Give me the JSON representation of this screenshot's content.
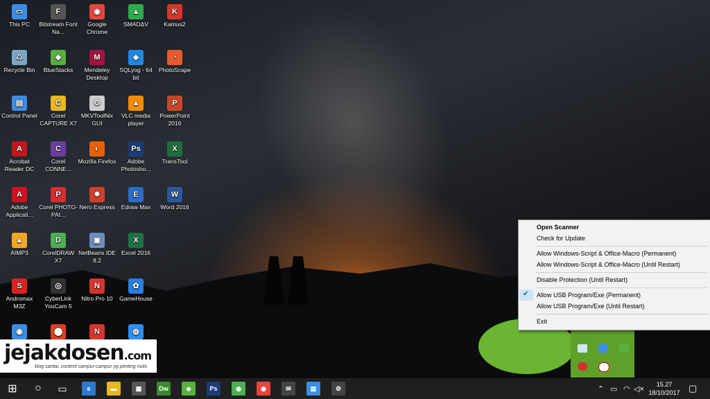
{
  "desktop": {
    "icons": [
      {
        "label": "This PC",
        "glyph": "▭",
        "color": "#3a8ee6"
      },
      {
        "label": "Recycle Bin",
        "glyph": "♺",
        "color": "#7aa7c7"
      },
      {
        "label": "Control Panel",
        "glyph": "▤",
        "color": "#3a8ee6"
      },
      {
        "label": "Acrobat Reader DC",
        "glyph": "A",
        "color": "#c4161c"
      },
      {
        "label": "Adobe Applicati...",
        "glyph": "A",
        "color": "#d4101c"
      },
      {
        "label": "AIMP3",
        "glyph": "▲",
        "color": "#f5a623"
      },
      {
        "label": "Andromax M3Z",
        "glyph": "S",
        "color": "#e02020"
      },
      {
        "label": "",
        "glyph": "◉",
        "color": "#3a8ee6"
      },
      {
        "label": "Bitstream Font Na...",
        "glyph": "F",
        "color": "#555555"
      },
      {
        "label": "BlueStacks",
        "glyph": "◆",
        "color": "#57b13a"
      },
      {
        "label": "Corel CAPTURE X7",
        "glyph": "C",
        "color": "#e8b820"
      },
      {
        "label": "Corel CONNE...",
        "glyph": "C",
        "color": "#6a3ea1"
      },
      {
        "label": "Corel PHOTO-PAI...",
        "glyph": "P",
        "color": "#d22f2f"
      },
      {
        "label": "CorelDRAW X7",
        "glyph": "D",
        "color": "#4caf50"
      },
      {
        "label": "CyberLink YouCam 5",
        "glyph": "◎",
        "color": "#333333"
      },
      {
        "label": "",
        "glyph": "⬤",
        "color": "#e04020"
      },
      {
        "label": "Google Chrome",
        "glyph": "◉",
        "color": "#e8453c"
      },
      {
        "label": "Mendeley Desktop",
        "glyph": "M",
        "color": "#a8123e"
      },
      {
        "label": "MKVToolNix GUI",
        "glyph": "⚙",
        "color": "#cccccc"
      },
      {
        "label": "Mozilla Firefox",
        "glyph": "◐",
        "color": "#e66000"
      },
      {
        "label": "Nero Express",
        "glyph": "✸",
        "color": "#d0402a"
      },
      {
        "label": "NetBeans IDE 8.2",
        "glyph": "▣",
        "color": "#6b8fc4"
      },
      {
        "label": "Nitro Pro 10",
        "glyph": "N",
        "color": "#d9342b"
      },
      {
        "label": "",
        "glyph": "N",
        "color": "#d9342b"
      },
      {
        "label": "SMADΔV",
        "glyph": "▲",
        "color": "#2eab4f"
      },
      {
        "label": "SQLyog - 64 bit",
        "glyph": "◈",
        "color": "#1e88e5"
      },
      {
        "label": "VLC media player",
        "glyph": "▲",
        "color": "#f28c00"
      },
      {
        "label": "Adobe Photosho...",
        "glyph": "Ps",
        "color": "#1d3b77"
      },
      {
        "label": "Edraw Max",
        "glyph": "E",
        "color": "#2c6cc7"
      },
      {
        "label": "Excel 2016",
        "glyph": "X",
        "color": "#1e7145"
      },
      {
        "label": "GameHouse",
        "glyph": "✿",
        "color": "#2a7de1"
      },
      {
        "label": "",
        "glyph": "◍",
        "color": "#2d8ef5"
      },
      {
        "label": "Kamus2",
        "glyph": "K",
        "color": "#d9342b"
      },
      {
        "label": "PhotoScape",
        "glyph": "◔",
        "color": "#e55b2d"
      },
      {
        "label": "PowerPoint 2016",
        "glyph": "P",
        "color": "#c8472a"
      },
      {
        "label": "TransTool",
        "glyph": "X",
        "color": "#1f6e3a"
      },
      {
        "label": "Word 2016",
        "glyph": "W",
        "color": "#2b579a"
      }
    ]
  },
  "watermark": {
    "main": "jejakdosen",
    "domain": ".com",
    "tagline": "blog santai, content campur-campur yg penting nulis"
  },
  "context_menu": {
    "open_scanner": "Open Scanner",
    "check_update": "Check for Update",
    "allow_script_perm": "Allow Windows-Script & Office-Macro (Permanent)",
    "allow_script_restart": "Allow Windows-Script & Office-Macro (Until Restart)",
    "disable_protection": "Disable Protection (Until Restart)",
    "allow_usb_perm": "Allow USB Program/Exe (Permanent)",
    "allow_usb_restart": "Allow USB Program/Exe (Until Restart)",
    "exit": "Exit",
    "check_glyph": "✔"
  },
  "taskbar": {
    "start_glyph": "⊞",
    "search_glyph": "○",
    "taskview_glyph": "▭",
    "apps": [
      {
        "name": "edge",
        "glyph": "e",
        "color": "#2a7ad2"
      },
      {
        "name": "file-explorer",
        "glyph": "▬",
        "color": "#e8b820"
      },
      {
        "name": "store",
        "glyph": "▦",
        "color": "#555555"
      },
      {
        "name": "dreamweaver",
        "glyph": "Dw",
        "color": "#3a8a2f"
      },
      {
        "name": "bluestacks",
        "glyph": "◆",
        "color": "#57b13a"
      },
      {
        "name": "photoshop",
        "glyph": "Ps",
        "color": "#1d3b77"
      },
      {
        "name": "android-studio",
        "glyph": "◉",
        "color": "#4caf50"
      },
      {
        "name": "chrome",
        "glyph": "◉",
        "color": "#e8453c"
      },
      {
        "name": "mail",
        "glyph": "✉",
        "color": "#444444"
      },
      {
        "name": "control-panel",
        "glyph": "▤",
        "color": "#3a8ee6"
      },
      {
        "name": "settings",
        "glyph": "⚙",
        "color": "#444444"
      }
    ],
    "tray": {
      "chevron": "⌃",
      "battery": "▭",
      "wifi": "◠",
      "volume": "◁×",
      "time": "15.27",
      "date": "18/10/2017",
      "notification": "▢"
    }
  }
}
